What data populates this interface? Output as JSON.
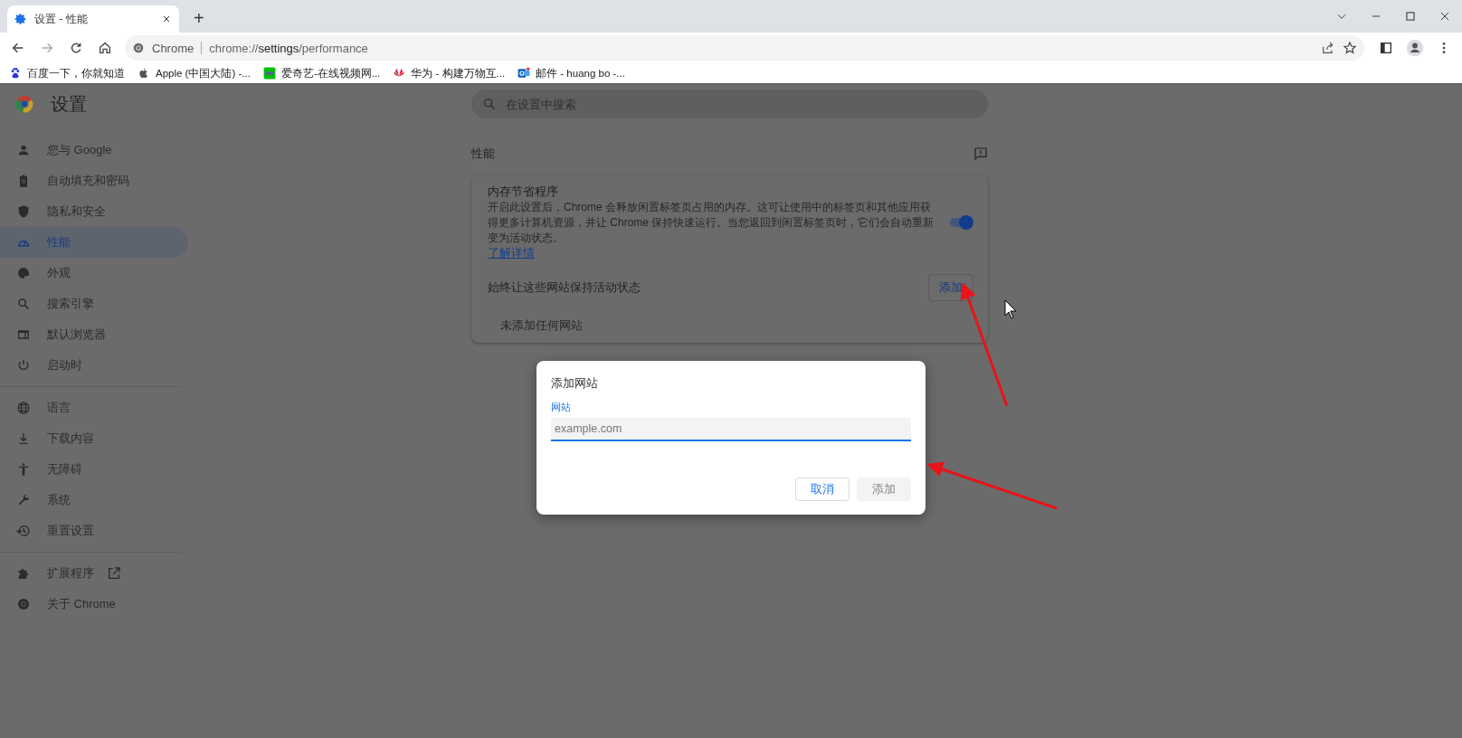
{
  "browser": {
    "tabs": [
      {
        "title": "设置 - 性能",
        "selected": true
      }
    ],
    "new_tab": "+",
    "address": {
      "site": "Chrome",
      "url_prefix": "chrome://",
      "url_host": "settings",
      "url_path": "/performance"
    },
    "bookmarks": [
      {
        "label": "百度一下，你就知道",
        "kind": "paw"
      },
      {
        "label": "Apple (中国大陆) -...",
        "kind": "apple"
      },
      {
        "label": "爱奇艺-在线视频网...",
        "kind": "iqiyi"
      },
      {
        "label": "华为 - 构建万物互...",
        "kind": "huawei"
      },
      {
        "label": "邮件 - huang bo -...",
        "kind": "mail"
      }
    ]
  },
  "settings": {
    "title": "设置",
    "search": {
      "placeholder": "在设置中搜索"
    },
    "nav_groups": [
      [
        {
          "label": "您与 Google",
          "kind": "person",
          "selected": false
        },
        {
          "label": "自动填充和密码",
          "kind": "clipboard",
          "selected": false
        },
        {
          "label": "隐私和安全",
          "kind": "shield",
          "selected": false
        },
        {
          "label": "性能",
          "kind": "gauge",
          "selected": true
        },
        {
          "label": "外观",
          "kind": "palette",
          "selected": false
        },
        {
          "label": "搜索引擎",
          "kind": "search",
          "selected": false
        },
        {
          "label": "默认浏览器",
          "kind": "browser",
          "selected": false
        },
        {
          "label": "启动时",
          "kind": "power",
          "selected": false
        }
      ],
      [
        {
          "label": "语言",
          "kind": "globe",
          "selected": false
        },
        {
          "label": "下载内容",
          "kind": "download",
          "selected": false
        },
        {
          "label": "无障碍",
          "kind": "accessibility",
          "selected": false
        },
        {
          "label": "系统",
          "kind": "wrench",
          "selected": false
        },
        {
          "label": "重置设置",
          "kind": "history",
          "selected": false
        }
      ],
      [
        {
          "label": "扩展程序",
          "kind": "puzzle",
          "selected": false,
          "external": true
        },
        {
          "label": "关于 Chrome",
          "kind": "chrome",
          "selected": false
        }
      ]
    ],
    "section_title": "性能",
    "card": {
      "title": "内存节省程序",
      "description": "开启此设置后，Chrome 会释放闲置标签页占用的内存。这可让使用中的标签页和其他应用获得更多计算机资源，并让 Chrome 保持快速运行。当您返回到闲置标签页时，它们会自动重新变为活动状态。",
      "link": "了解详情",
      "toggle_on": true,
      "sites_label": "始终让这些网站保持活动状态",
      "add_button": "添加",
      "empty_text": "未添加任何网站"
    }
  },
  "dialog": {
    "title": "添加网站",
    "field_label": "网站",
    "placeholder": "example.com",
    "buttons": [
      {
        "label": "取消",
        "disabled": false
      },
      {
        "label": "添加",
        "disabled": true
      }
    ]
  }
}
